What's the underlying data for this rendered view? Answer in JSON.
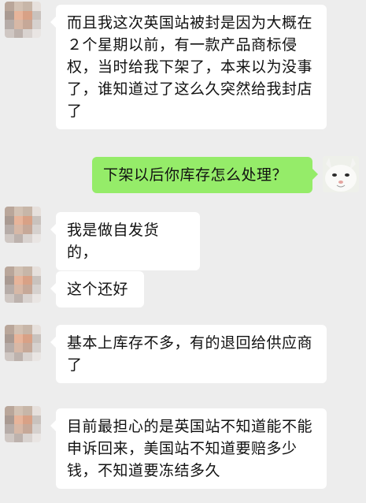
{
  "messages": [
    {
      "side": "in",
      "text": "而且我这次英国站被封是因为大概在２个星期以前，有一款产品商标侵权，当时给我下架了，本来以为没事了，谁知道过了这么久突然给我封店了"
    },
    {
      "side": "out",
      "text": "下架以后你库存怎么处理？"
    },
    {
      "side": "in",
      "text": "我是做自发货的，"
    },
    {
      "side": "in",
      "text": "这个还好"
    },
    {
      "side": "in",
      "text": "基本上库存不多，有的退回给供应商了"
    },
    {
      "side": "in",
      "text": "目前最担心的是英国站不知道能不能申诉回来，美国站不知道要赔多少钱，不知道要冻结多久"
    }
  ],
  "colors": {
    "background": "#ededed",
    "incoming_bubble": "#ffffff",
    "outgoing_bubble": "#95ec69"
  }
}
